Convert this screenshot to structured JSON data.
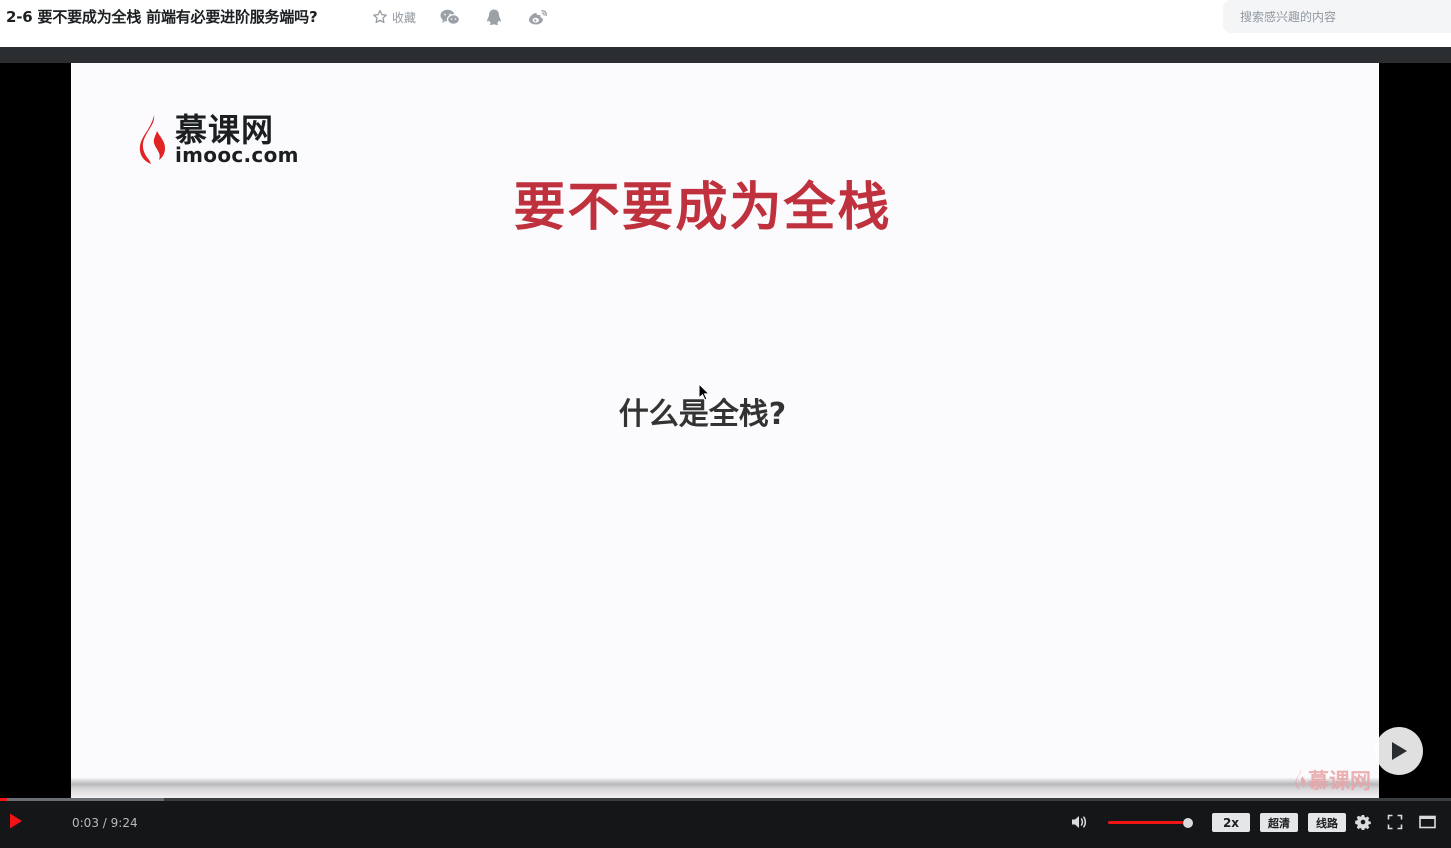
{
  "header": {
    "title": "2-6 要不要成为全栈 前端有必要进阶服务端吗?",
    "collect_label": "收藏",
    "share_icons": [
      "wechat-icon",
      "qq-icon",
      "weibo-icon"
    ],
    "search_placeholder": "搜索感兴趣的内容"
  },
  "slide": {
    "logo_cn": "慕课网",
    "logo_en": "imooc.com",
    "title": "要不要成为全栈",
    "question": "什么是全栈?",
    "watermark": "慕课网"
  },
  "player": {
    "time_current": "0:03",
    "time_separator": "/",
    "time_total": "9:24",
    "progress_played_fraction": 0.005,
    "progress_buffered_fraction": 0.113,
    "volume_fraction": 0.94,
    "speed_label": "2x",
    "quality_label": "超清",
    "line_label": "线路"
  },
  "colors": {
    "accent_red": "#f01414",
    "slide_title_red": "#c0313e",
    "control_bg": "#141618"
  }
}
